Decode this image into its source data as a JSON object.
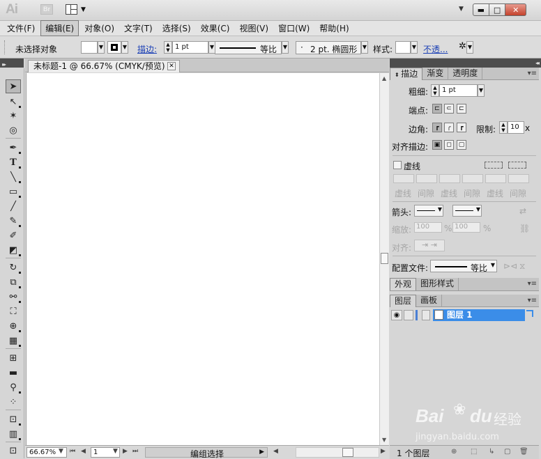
{
  "titlebar": {
    "app_logo": "Ai",
    "bridge_logo": "Br"
  },
  "menu": [
    "文件(F)",
    "编辑(E)",
    "对象(O)",
    "文字(T)",
    "选择(S)",
    "效果(C)",
    "视图(V)",
    "窗口(W)",
    "帮助(H)"
  ],
  "menu_active_index": 1,
  "control": {
    "selection_label": "未选择对象",
    "stroke_label": "描边:",
    "stroke_weight": "1 pt",
    "profile_label": "等比",
    "brush_label": "2 pt. 椭圆形",
    "brush_dot": "·",
    "style_label": "样式:",
    "opacity_link": "不透..."
  },
  "document": {
    "tab_title": "未标题-1 @ 66.67% (CMYK/预览)",
    "close_glyph": "✕"
  },
  "status": {
    "zoom": "66.67%",
    "page": "1",
    "tool_status": "编组选择"
  },
  "stroke_panel": {
    "tabs": [
      "描边",
      "渐变",
      "透明度"
    ],
    "active_tab": "描边",
    "weight_label": "粗细:",
    "weight_value": "1 pt",
    "cap_label": "端点:",
    "corner_label": "边角:",
    "limit_label": "限制:",
    "limit_value": "10",
    "limit_unit": "x",
    "align_label": "对齐描边:",
    "dashed_label": "虚线",
    "dash_headers": [
      "虚线",
      "间隙",
      "虚线",
      "间隙",
      "虚线",
      "间隙"
    ],
    "arrow_label": "箭头:",
    "scale_label": "缩放:",
    "scale_value_1": "100",
    "scale_value_2": "100",
    "percent": "%",
    "align_arrow_label": "对齐:",
    "profile_label": "配置文件:",
    "profile_value": "等比"
  },
  "appearance_panel": {
    "tabs": [
      "外观",
      "图形样式"
    ],
    "active_tab": "外观"
  },
  "layers_panel": {
    "tabs": [
      "图层",
      "画板"
    ],
    "active_tab": "图层",
    "layers": [
      {
        "name": "图层 1",
        "selected": true
      }
    ],
    "footer_count": "1 个图层"
  },
  "watermark": {
    "brand": "Bai",
    "paw": "du",
    "suffix": "经验",
    "url": "jingyan.baidu.com"
  },
  "colors": {
    "layer_highlight": "#3b8de8",
    "link": "#1a3fb5",
    "close_button": "#c4422c"
  }
}
